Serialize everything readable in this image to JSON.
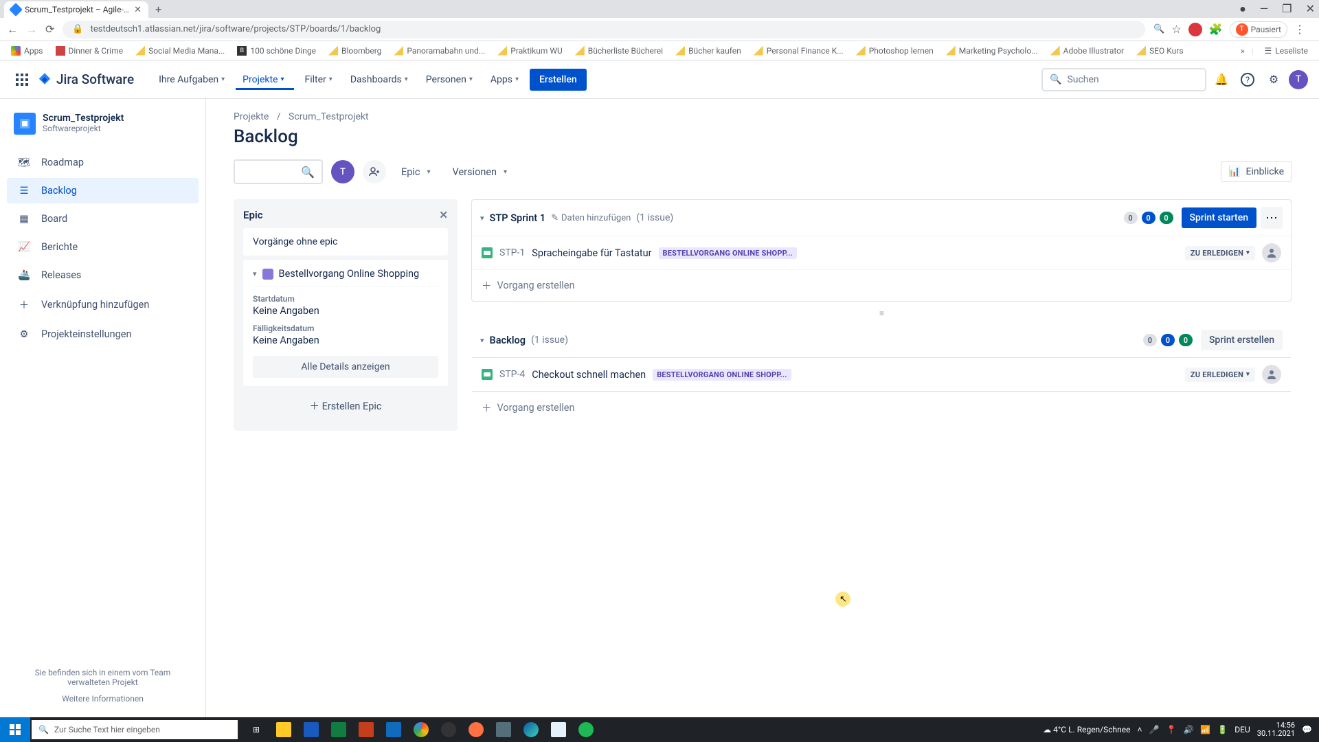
{
  "browser": {
    "tab_title": "Scrum_Testprojekt – Agile-Board",
    "url": "testdeutsch1.atlassian.net/jira/software/projects/STP/boards/1/backlog",
    "pausiert": "Pausiert",
    "bookmarks": [
      "Apps",
      "Dinner & Crime",
      "Social Media Mana...",
      "100 schöne Dinge",
      "Bloomberg",
      "Panoramabahn und...",
      "Praktikum WU",
      "Bücherliste Bücherei",
      "Bücher kaufen",
      "Personal Finance K...",
      "Photoshop lernen",
      "Marketing Psycholo...",
      "Adobe Illustrator",
      "SEO Kurs"
    ],
    "reading_list": "Leseliste"
  },
  "jira_nav": {
    "product": "Jira Software",
    "items": [
      "Ihre Aufgaben",
      "Projekte",
      "Filter",
      "Dashboards",
      "Personen",
      "Apps"
    ],
    "create": "Erstellen",
    "search_placeholder": "Suchen"
  },
  "sidebar": {
    "project_name": "Scrum_Testprojekt",
    "project_type": "Softwareprojekt",
    "items": [
      "Roadmap",
      "Backlog",
      "Board",
      "Berichte",
      "Releases",
      "Verknüpfung hinzufügen",
      "Projekteinstellungen"
    ],
    "footer": "Sie befinden sich in einem vom Team verwalteten Projekt",
    "footer_link": "Weitere Informationen"
  },
  "breadcrumb": {
    "a": "Projekte",
    "b": "Scrum_Testprojekt"
  },
  "page_title": "Backlog",
  "filters": {
    "epic": "Epic",
    "versions": "Versionen",
    "insights": "Einblicke"
  },
  "epic_panel": {
    "title": "Epic",
    "without_epic": "Vorgänge ohne epic",
    "epic_name": "Bestellvorgang Online Shopping",
    "start_label": "Startdatum",
    "start_val": "Keine Angaben",
    "due_label": "Fälligkeitsdatum",
    "due_val": "Keine Angaben",
    "details_btn": "Alle Details anzeigen",
    "create_epic": "Erstellen Epic"
  },
  "sprint": {
    "name": "STP Sprint 1",
    "add_dates": "Daten hinzufügen",
    "count": "(1 issue)",
    "counts": [
      "0",
      "0",
      "0"
    ],
    "start_btn": "Sprint starten",
    "issue": {
      "key": "STP-1",
      "title": "Spracheingabe für Tastatur",
      "epic": "BESTELLVORGANG ONLINE SHOPP...",
      "status": "ZU ERLEDIGEN"
    },
    "create_issue": "Vorgang erstellen"
  },
  "backlog": {
    "name": "Backlog",
    "count": "(1 issue)",
    "counts": [
      "0",
      "0",
      "0"
    ],
    "create_sprint": "Sprint erstellen",
    "issue": {
      "key": "STP-4",
      "title": "Checkout schnell machen",
      "epic": "BESTELLVORGANG ONLINE SHOPP...",
      "status": "ZU ERLEDIGEN"
    },
    "create_issue": "Vorgang erstellen"
  },
  "taskbar": {
    "search": "Zur Suche Text hier eingeben",
    "weather": "4°C  L. Regen/Schnee",
    "lang": "DEU",
    "time": "14:56",
    "date": "30.11.2021"
  }
}
